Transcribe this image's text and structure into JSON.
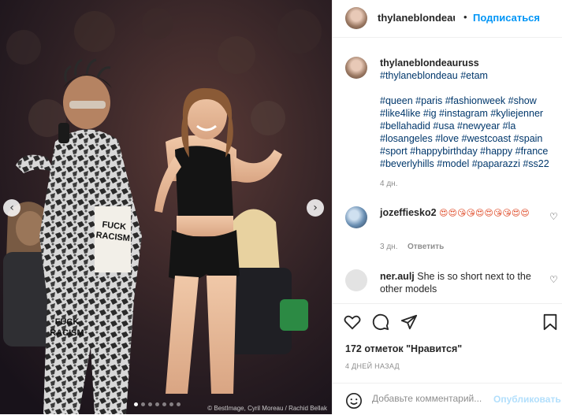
{
  "photo": {
    "credit": "© BestImage, Cyril Moreau / Rachid Bellak",
    "prev_glyph": "‹",
    "next_glyph": "›",
    "dots_total": 7,
    "active_dot": 0,
    "shirt_text_1": "FUCK",
    "shirt_text_2": "RACISM",
    "pants_text_1": "FUCK",
    "pants_text_2": "RACISM"
  },
  "header": {
    "username": "thylaneblondeauru",
    "separator": "•",
    "follow_label": "Подписаться"
  },
  "caption": {
    "username": "thylaneblondeauruss",
    "line1": "#thylaneblondeau",
    "line2": "#etam",
    "hashtags": "#queen #paris #fashionweek #show #like4like #ig #instagram #kyliejenner #bellahadid #usa #newyear #la #losangeles #love #westcoast #spain #sport #happybirthday #happy #france #beverlyhills #model #paparazzi #ss22",
    "time": "4 дн."
  },
  "comments": [
    {
      "username": "jozeffiesko2",
      "text": "😍😍😘😘😍😍😘😘😍😍",
      "time": "3 дн.",
      "reply_label": "Ответить"
    },
    {
      "username": "ner.aulj",
      "text": "She is so short next to the other models"
    }
  ],
  "actions": {
    "like_icon": "heart-icon",
    "comment_icon": "comment-icon",
    "share_icon": "paper-plane-icon",
    "save_icon": "bookmark-icon",
    "likes": "172 отметок \"Нравится\"",
    "date": "4 ДНЕЙ НАЗАД"
  },
  "comment_bar": {
    "placeholder": "Добавьте комментарий...",
    "publish_label": "Опубликовать"
  },
  "colors": {
    "link_blue": "#0095f6",
    "hashtag": "#00376b",
    "muted": "#8e8e8e",
    "publish_disabled": "#b2dffc"
  }
}
